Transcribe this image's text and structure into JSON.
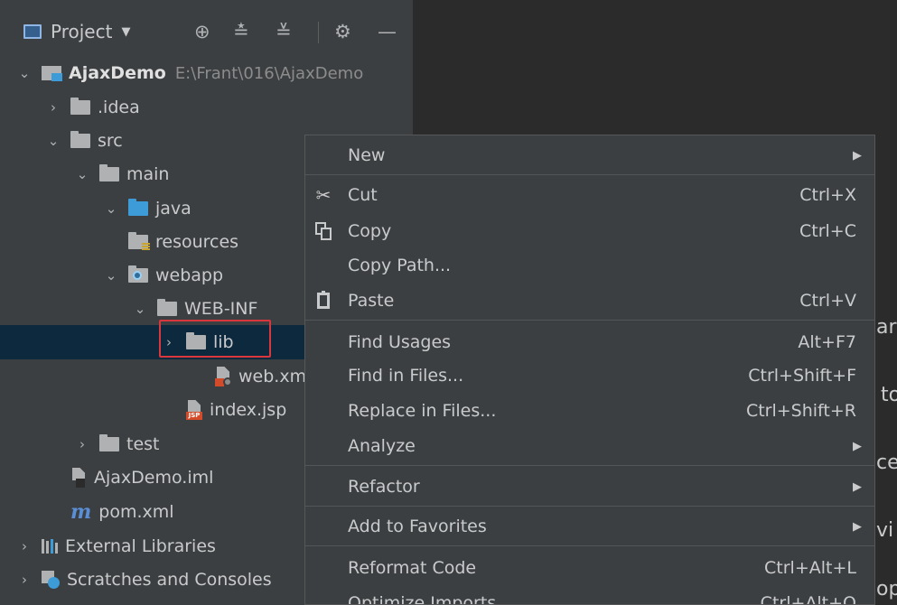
{
  "toolbar": {
    "project_label": "Project",
    "icons": [
      "locate-icon",
      "expand-all-icon",
      "collapse-all-icon",
      "gear-icon",
      "minimize-icon"
    ]
  },
  "tree": {
    "root_name": "AjaxDemo",
    "root_path": "E:\\Frant\\016\\AjaxDemo",
    "idea": ".idea",
    "src": "src",
    "main": "main",
    "java": "java",
    "resources": "resources",
    "webapp": "webapp",
    "webinf": "WEB-INF",
    "lib": "lib",
    "webxml": "web.xml",
    "indexjsp": "index.jsp",
    "test": "test",
    "iml": "AjaxDemo.iml",
    "pom": "pom.xml",
    "external": "External Libraries",
    "scratches": "Scratches and Consoles"
  },
  "editor_fragments": [
    "ar",
    "to",
    "ce",
    "vi",
    "op"
  ],
  "menu": {
    "new": "New",
    "cut": "Cut",
    "cut_sc": "Ctrl+X",
    "copy": "Copy",
    "copy_sc": "Ctrl+C",
    "copy_path": "Copy Path...",
    "paste": "Paste",
    "paste_sc": "Ctrl+V",
    "find_usages": "Find Usages",
    "find_usages_sc": "Alt+F7",
    "find_in_files": "Find in Files...",
    "find_in_files_sc": "Ctrl+Shift+F",
    "replace_in_files": "Replace in Files...",
    "replace_in_files_sc": "Ctrl+Shift+R",
    "analyze": "Analyze",
    "refactor": "Refactor",
    "add_favorites": "Add to Favorites",
    "reformat": "Reformat Code",
    "reformat_sc": "Ctrl+Alt+L",
    "optimize": "Optimize Imports",
    "optimize_sc": "Ctrl+Alt+O"
  }
}
